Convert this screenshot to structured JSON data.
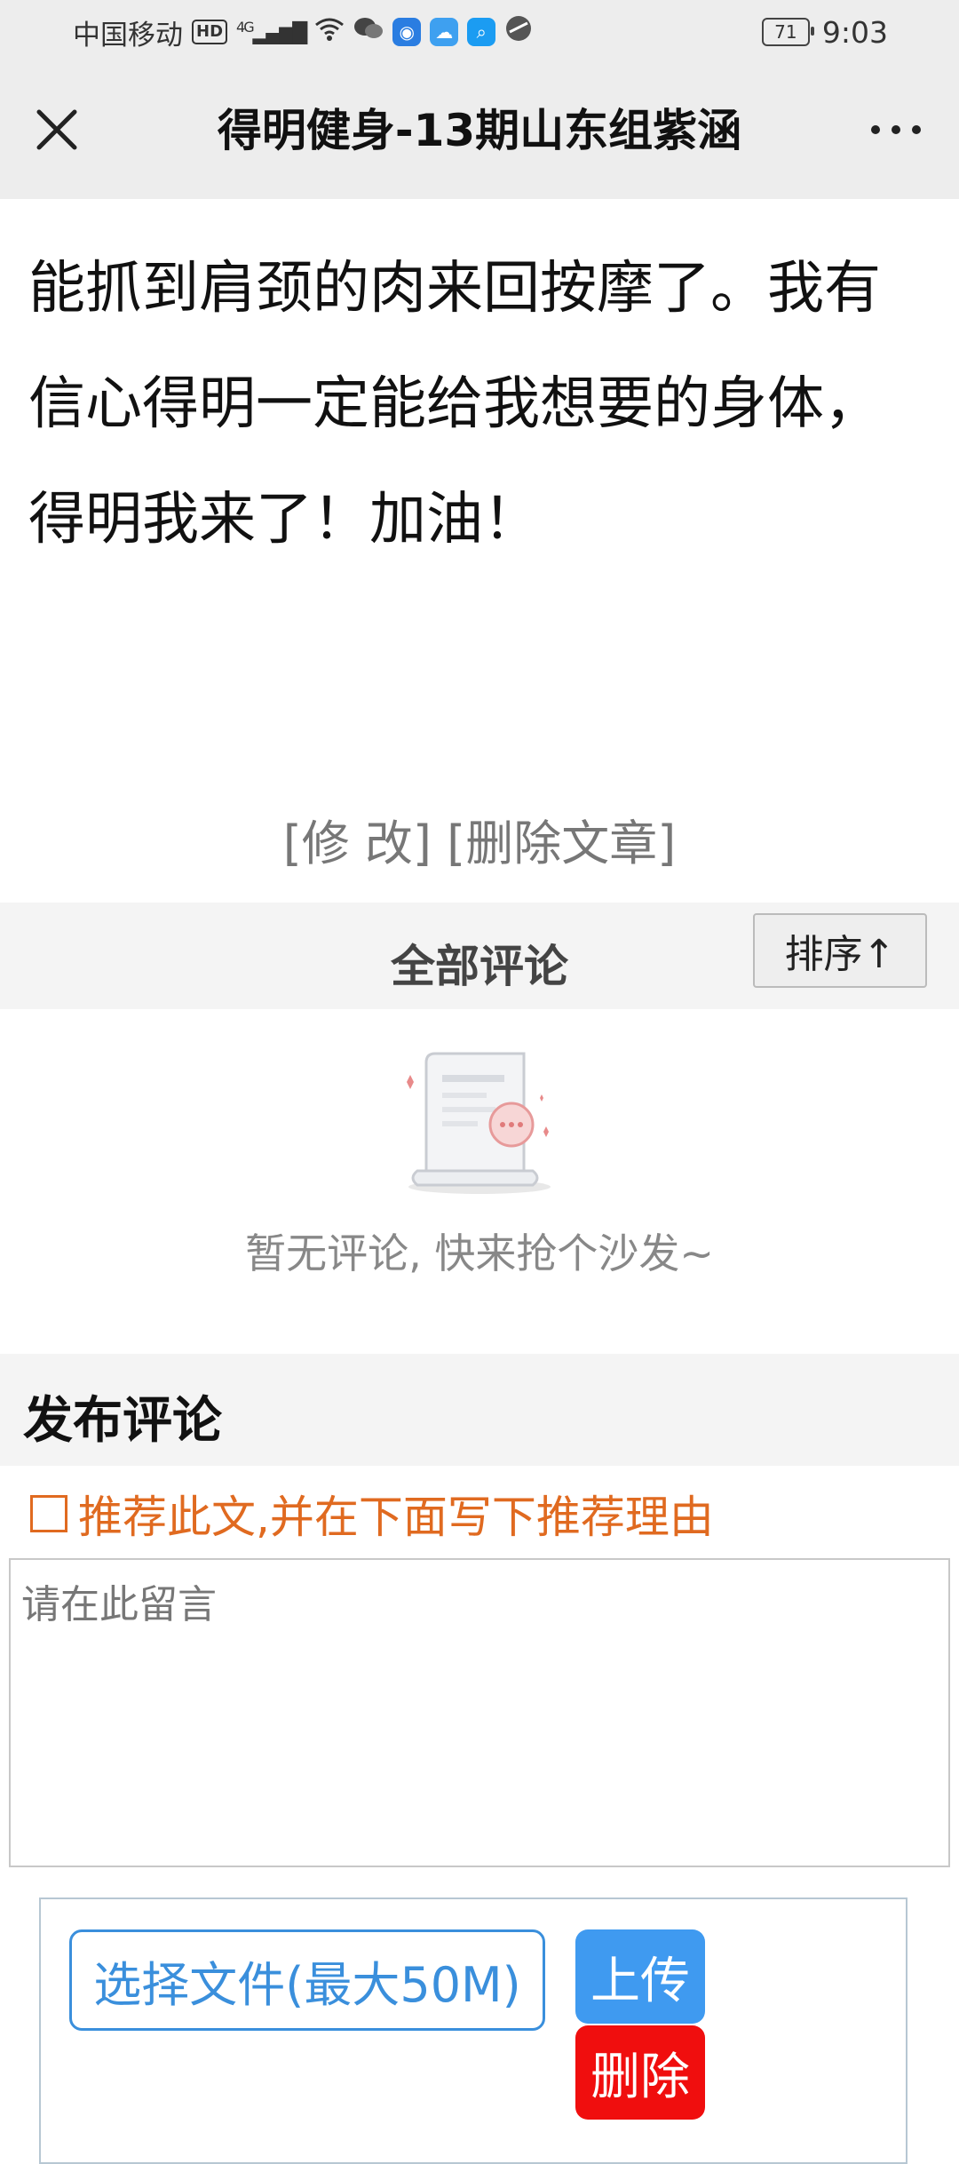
{
  "status_bar": {
    "carrier": "中国移动",
    "hd_badge": "HD",
    "network": "4G",
    "battery_level": "71",
    "time": "9:03",
    "icons": [
      "signal-icon",
      "wifi-icon",
      "wechat-icon",
      "bulb-app-icon",
      "cloud-app-icon",
      "search-app-icon",
      "browser-app-icon"
    ]
  },
  "nav": {
    "title": "得明健身-13期山东组紫涵",
    "close_symbol": "✕",
    "more_symbol": "•••"
  },
  "article": {
    "lines": [
      "能抓到肩颈的肉来回按摩了。我有",
      "信心得明一定能给我想要的身体，",
      "得明我来了！加油！"
    ]
  },
  "actions": {
    "edit": "[修 改]",
    "delete_article": "[删除文章]"
  },
  "comments": {
    "header": "全部评论",
    "sort_label": "排序↑",
    "empty_text": "暂无评论, 快来抢个沙发~"
  },
  "post": {
    "title": "发布评论",
    "recommend_label": "推荐此文,并在下面写下推荐理由",
    "placeholder": "请在此留言",
    "choose_file": "选择文件(最大50M)",
    "upload": "上传",
    "delete": "删除"
  },
  "colors": {
    "accent_blue": "#3f9af0",
    "danger_red": "#f00e0e",
    "recommend_orange": "#e06a20"
  }
}
